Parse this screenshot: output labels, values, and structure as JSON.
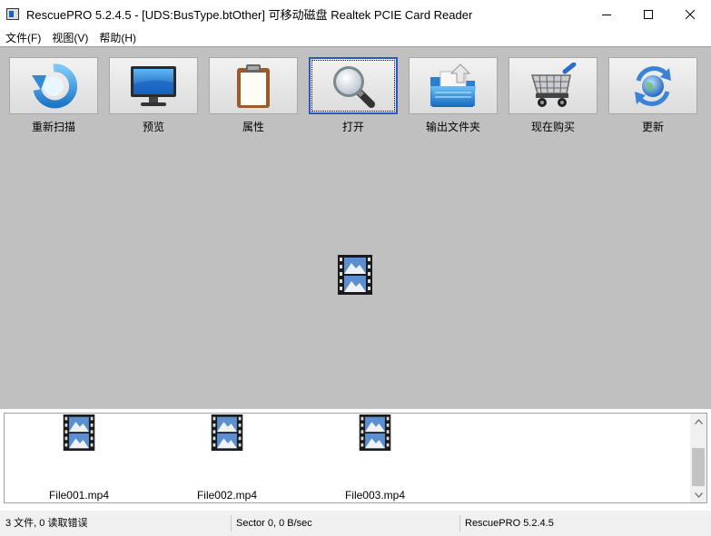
{
  "window": {
    "title": "RescuePRO 5.2.4.5 - [UDS:BusType.btOther] 可移动磁盘 Realtek PCIE Card Reader"
  },
  "menu": [
    {
      "label": "文件(F)"
    },
    {
      "label": "视图(V)"
    },
    {
      "label": "帮助(H)"
    }
  ],
  "toolbar": [
    {
      "label": "重新扫描",
      "icon": "refresh-icon"
    },
    {
      "label": "预览",
      "icon": "monitor-icon"
    },
    {
      "label": "属性",
      "icon": "clipboard-icon"
    },
    {
      "label": "打开",
      "icon": "magnifier-icon",
      "active": true
    },
    {
      "label": "输出文件夹",
      "icon": "folder-export-icon"
    },
    {
      "label": "现在购买",
      "icon": "shopping-cart-icon"
    },
    {
      "label": "更新",
      "icon": "update-globe-icon"
    }
  ],
  "files": [
    {
      "name": "File001.mp4",
      "icon": "video-file-icon"
    },
    {
      "name": "File002.mp4",
      "icon": "video-file-icon"
    },
    {
      "name": "File003.mp4",
      "icon": "video-file-icon"
    }
  ],
  "status": {
    "files": "3 文件, 0 读取错误",
    "sector": "Sector 0, 0 B/sec",
    "version": "RescuePRO 5.2.4.5"
  },
  "colors": {
    "workspace": "#c0c0c0",
    "active_border": "#2a56c6"
  }
}
